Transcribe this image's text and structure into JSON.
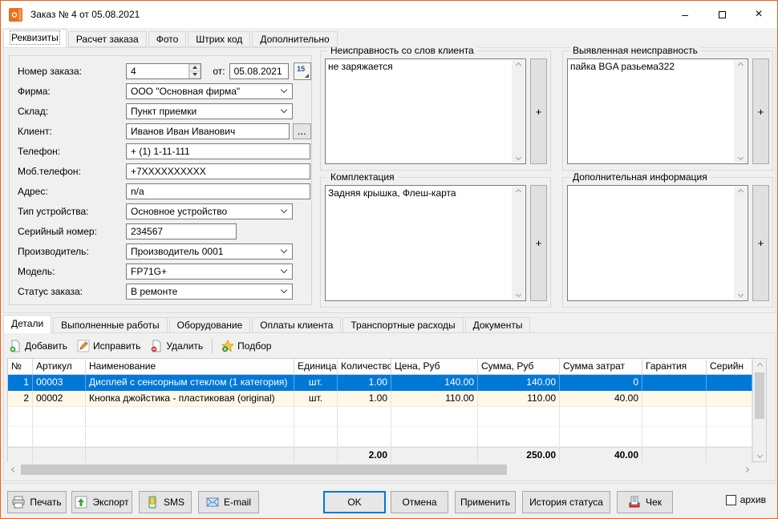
{
  "window": {
    "title": "Заказ № 4 от 05.08.2021"
  },
  "icons": {
    "minimize": "–",
    "close": "×",
    "browse": "...",
    "plus": "+",
    "calendar_day": "15"
  },
  "tabs_top": [
    "Реквизиты",
    "Расчет заказа",
    "Фото",
    "Штрих код",
    "Дополнительно"
  ],
  "form": {
    "order_number": {
      "label": "Номер заказа:",
      "value": "4"
    },
    "order_date": {
      "label": "от:",
      "value": "05.08.2021"
    },
    "firm": {
      "label": "Фирма:",
      "value": "ООО \"Основная фирма\""
    },
    "warehouse": {
      "label": "Склад:",
      "value": "Пункт приемки"
    },
    "client": {
      "label": "Клиент:",
      "value": "Иванов Иван Иванович"
    },
    "phone": {
      "label": "Телефон:",
      "value": "+ (1) 1-11-111"
    },
    "mobile": {
      "label": "Моб.телефон:",
      "value": "+7XXXXXXXXXX"
    },
    "address": {
      "label": "Адрес:",
      "value": "n/a"
    },
    "device_type": {
      "label": "Тип устройства:",
      "value": "Основное устройство"
    },
    "serial": {
      "label": "Серийный номер:",
      "value": "234567"
    },
    "manufacturer": {
      "label": "Производитель:",
      "value": "Производитель 0001"
    },
    "model": {
      "label": "Модель:",
      "value": "FP71G+"
    },
    "status": {
      "label": "Статус заказа:",
      "value": "В ремонте"
    }
  },
  "panels": [
    {
      "title": "Неисправность со слов клиента",
      "text": "не заряжается"
    },
    {
      "title": "Выявленная неисправность",
      "text": "пайка BGA разьема322"
    },
    {
      "title": "Комплектация",
      "text": "Задняя крышка, Флеш-карта"
    },
    {
      "title": "Дополнительная информация",
      "text": ""
    }
  ],
  "tabs_bottom": [
    "Детали",
    "Выполненные работы",
    "Оборудование",
    "Оплаты клиента",
    "Транспортные расходы",
    "Документы"
  ],
  "toolbar": {
    "add": "Добавить",
    "edit": "Исправить",
    "delete": "Удалить",
    "select": "Подбор"
  },
  "table": {
    "columns": [
      "№",
      "Артикул",
      "Наименование",
      "Единица",
      "Количество",
      "Цена, Руб",
      "Сумма, Руб",
      "Сумма затрат",
      "Гарантия",
      "Серийн"
    ],
    "rows": [
      {
        "num": "1",
        "article": "00003",
        "name": "Дисплей с сенсорным стеклом (1 категория)",
        "unit": "шт.",
        "qty": "1.00",
        "price": "140.00",
        "sum": "140.00",
        "cost": "0",
        "warranty": "",
        "serial": ""
      },
      {
        "num": "2",
        "article": "00002",
        "name": "Кнопка джойстика - пластиковая (original)",
        "unit": "шт.",
        "qty": "1.00",
        "price": "110.00",
        "sum": "110.00",
        "cost": "40.00",
        "warranty": "",
        "serial": ""
      }
    ],
    "totals": {
      "qty": "2.00",
      "sum": "250.00",
      "cost": "40.00"
    }
  },
  "footer": {
    "print": "Печать",
    "export": "Экспорт",
    "sms": "SMS",
    "email": "E-mail",
    "ok": "OK",
    "cancel": "Отмена",
    "apply": "Применить",
    "history": "История статуса",
    "receipt": "Чек",
    "archive": "архив"
  },
  "colors": {
    "accent_orange": "#ed6e1e",
    "selection_blue": "#0078d7",
    "row_alt": "#fdf8e8"
  }
}
